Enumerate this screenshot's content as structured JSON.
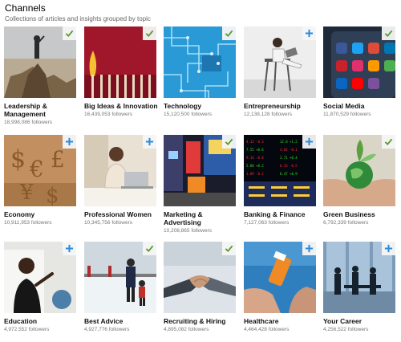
{
  "header": {
    "title": "Channels",
    "subtitle": "Collections of articles and insights grouped by topic"
  },
  "colors": {
    "followed_check": "#5a9a32",
    "follow_plus": "#2a8bdc"
  },
  "channels": [
    {
      "name": "Leadership & Management",
      "followers": "18,998,086 followers",
      "status": "followed",
      "icon": "check-icon"
    },
    {
      "name": "Big Ideas & Innovation",
      "followers": "16,439,053 followers",
      "status": "followed",
      "icon": "check-icon"
    },
    {
      "name": "Technology",
      "followers": "15,120,500 followers",
      "status": "followed",
      "icon": "check-icon"
    },
    {
      "name": "Entrepreneurship",
      "followers": "12,138,128 followers",
      "status": "not_followed",
      "icon": "plus-icon"
    },
    {
      "name": "Social Media",
      "followers": "11,870,529 followers",
      "status": "followed",
      "icon": "check-icon"
    },
    {
      "name": "Economy",
      "followers": "10,911,953 followers",
      "status": "not_followed",
      "icon": "plus-icon"
    },
    {
      "name": "Professional Women",
      "followers": "10,345,756 followers",
      "status": "not_followed",
      "icon": "plus-icon"
    },
    {
      "name": "Marketing & Advertising",
      "followers": "10,208,865 followers",
      "status": "followed",
      "icon": "check-icon"
    },
    {
      "name": "Banking & Finance",
      "followers": "7,127,063 followers",
      "status": "not_followed",
      "icon": "plus-icon"
    },
    {
      "name": "Green Business",
      "followers": "6,792,339 followers",
      "status": "followed",
      "icon": "check-icon"
    },
    {
      "name": "Education",
      "followers": "4,972,552 followers",
      "status": "not_followed",
      "icon": "plus-icon"
    },
    {
      "name": "Best Advice",
      "followers": "4,927,776 followers",
      "status": "followed",
      "icon": "check-icon"
    },
    {
      "name": "Recruiting & Hiring",
      "followers": "4,895,082 followers",
      "status": "followed",
      "icon": "check-icon"
    },
    {
      "name": "Healthcare",
      "followers": "4,464,428 followers",
      "status": "not_followed",
      "icon": "plus-icon"
    },
    {
      "name": "Your Career",
      "followers": "4,256,522 followers",
      "status": "not_followed",
      "icon": "plus-icon"
    }
  ]
}
